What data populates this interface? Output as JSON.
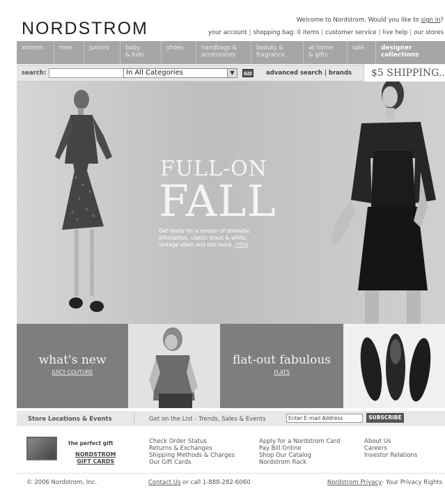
{
  "header": {
    "logo": "NORDSTROM",
    "welcome_text": "Welcome to Nordstrom. Would you like to",
    "sign_in": "sign in",
    "sign_in_suffix": "?",
    "utility_links": [
      "your account",
      "shopping bag: 0 items",
      "customer service",
      "live help",
      "our stores"
    ]
  },
  "nav": {
    "items": [
      {
        "label": "women",
        "w": 54
      },
      {
        "label": "men",
        "w": 43
      },
      {
        "label": "juniors",
        "w": 52
      },
      {
        "label": "baby\n& kids",
        "w": 59
      },
      {
        "label": "shoes",
        "w": 50
      },
      {
        "label": "handbags &\naccessories",
        "w": 79
      },
      {
        "label": "beauty &\nfragrance",
        "w": 75
      },
      {
        "label": "at home\n& gifts",
        "w": 63
      },
      {
        "label": "sale",
        "w": 41
      }
    ],
    "designer": "designer\ncollections"
  },
  "search": {
    "label": "search:",
    "category": "In All Categories",
    "go": "GO",
    "advanced": "advanced search",
    "brands": "brands",
    "shipping": "$5 SHIPPING..."
  },
  "hero": {
    "title_line1": "FULL-ON",
    "title_line2": "FALL",
    "description": "Get ready for a season of dramatic silhouettes, classic black & white, vintage vibes and lots more.",
    "view": "VIEW"
  },
  "tiles": {
    "whats_new": "what's new",
    "whats_new_link": "JUICY COUTURE",
    "flat_out": "flat-out fabulous",
    "flats_link": "FLATS"
  },
  "subscribe_bar": {
    "store_events": "Store Locations & Events",
    "get_on_list": "Get on the List - Trends, Sales & Events",
    "email_placeholder": "Enter E-mail Address",
    "subscribe": "SUBSCRIBE"
  },
  "gift": {
    "perfect_gift": "the perfect gift",
    "gift_cards_line1": "NORDSTROM",
    "gift_cards_line2": "GIFT CARDS"
  },
  "links": {
    "col1": [
      "Check Order Status",
      "Returns & Exchanges",
      "Shipping Methods & Charges",
      "Our Gift Cards"
    ],
    "col2": [
      "Apply for a Nordstrom Card",
      "Pay Bill Online",
      "Shop Our Catalog",
      "Nordstrom Rack"
    ],
    "col3": [
      "About Us",
      "Careers",
      "Investor Relations"
    ]
  },
  "footer": {
    "copyright": "© 2006 Nordstrom, Inc.",
    "contact_us": "Contact Us",
    "call": " or call 1-888-282-6060",
    "privacy": "Nordstrom Privacy",
    "rights": "- Your Privacy Rights"
  }
}
